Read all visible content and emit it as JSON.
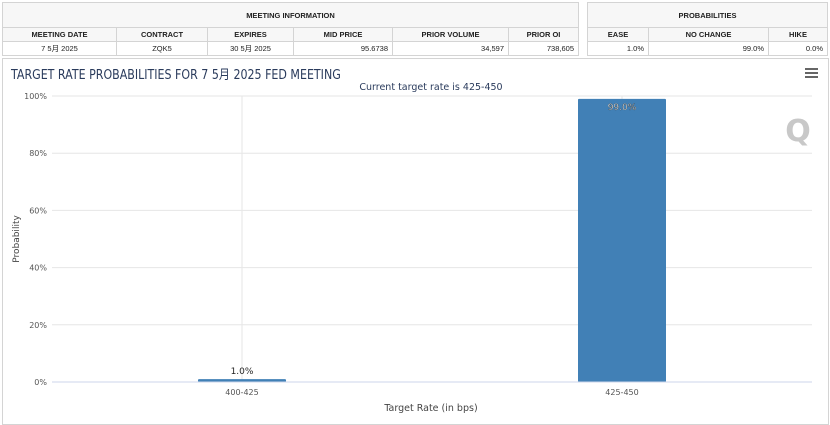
{
  "meeting_info": {
    "title": "MEETING INFORMATION",
    "headers": [
      "MEETING DATE",
      "CONTRACT",
      "EXPIRES",
      "MID PRICE",
      "PRIOR VOLUME",
      "PRIOR OI"
    ],
    "values": [
      "7 5月 2025",
      "ZQK5",
      "30 5月 2025",
      "95.6738",
      "34,597",
      "738,605"
    ]
  },
  "probabilities": {
    "title": "PROBABILITIES",
    "headers": [
      "EASE",
      "NO CHANGE",
      "HIKE"
    ],
    "values": [
      "1.0%",
      "99.0%",
      "0.0%"
    ]
  },
  "chart_panel": {
    "title": "TARGET RATE PROBABILITIES FOR 7 5月 2025 FED MEETING",
    "menu_icon": "hamburger-icon",
    "watermark": "Q"
  },
  "chart_data": {
    "type": "bar",
    "title": "Current target rate is 425-450",
    "xlabel": "Target Rate (in bps)",
    "ylabel": "Probability",
    "categories": [
      "400-425",
      "425-450"
    ],
    "values": [
      1.0,
      99.0
    ],
    "data_labels": [
      "1.0%",
      "99.0%"
    ],
    "ylim": [
      0,
      100
    ],
    "yticks": [
      "0%",
      "20%",
      "40%",
      "60%",
      "80%",
      "100%"
    ],
    "color": "#4180b6",
    "grid": true
  }
}
